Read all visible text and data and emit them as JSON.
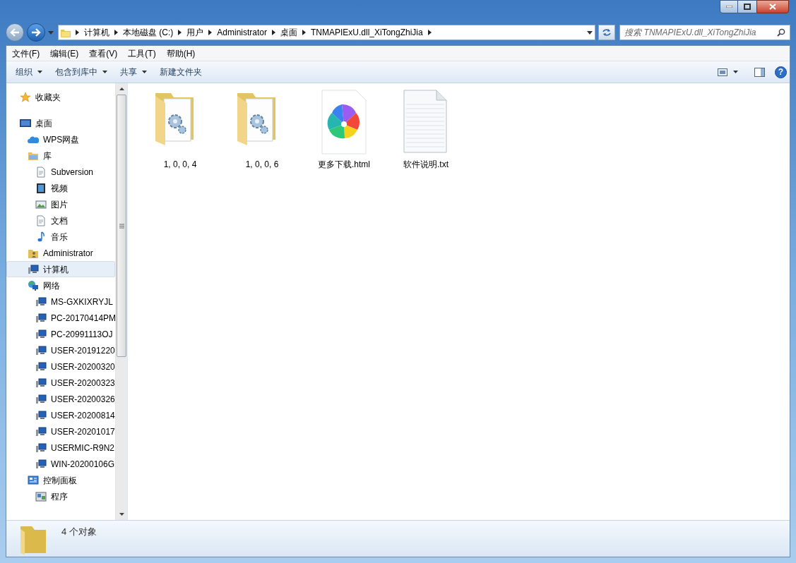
{
  "address_bar": {
    "segments": [
      "计算机",
      "本地磁盘 (C:)",
      "用户",
      "Administrator",
      "桌面",
      "TNMAPIExU.dll_XiTongZhiJia"
    ]
  },
  "search": {
    "placeholder": "搜索 TNMAPIExU.dll_XiTongZhiJia"
  },
  "menu_bar": [
    "文件(F)",
    "编辑(E)",
    "查看(V)",
    "工具(T)",
    "帮助(H)"
  ],
  "toolbar": [
    {
      "label": "组织",
      "dropdown": true
    },
    {
      "label": "包含到库中",
      "dropdown": true
    },
    {
      "label": "共享",
      "dropdown": true
    },
    {
      "label": "新建文件夹",
      "dropdown": false
    }
  ],
  "help_button": {
    "label": "?"
  },
  "sidebar": {
    "items": [
      {
        "label": "收藏夹",
        "kind": "star",
        "selected": false
      },
      {
        "label": "桌面",
        "kind": "desktop",
        "selected": false,
        "children": [
          {
            "label": "WPS网盘",
            "kind": "cloud",
            "selected": false
          },
          {
            "label": "库",
            "kind": "library",
            "selected": false,
            "children": [
              {
                "label": "Subversion",
                "kind": "document",
                "selected": false
              },
              {
                "label": "视频",
                "kind": "video",
                "selected": false
              },
              {
                "label": "图片",
                "kind": "picture",
                "selected": false
              },
              {
                "label": "文档",
                "kind": "document",
                "selected": false
              },
              {
                "label": "音乐",
                "kind": "music",
                "selected": false
              }
            ]
          },
          {
            "label": "Administrator",
            "kind": "user",
            "selected": false
          },
          {
            "label": "计算机",
            "kind": "computer",
            "selected": true
          },
          {
            "label": "网络",
            "kind": "network",
            "selected": false,
            "children": [
              {
                "label": "MS-GXKIXRYJL",
                "kind": "computer",
                "selected": false
              },
              {
                "label": "PC-20170414PM",
                "kind": "computer",
                "selected": false
              },
              {
                "label": "PC-20991113OJ",
                "kind": "computer",
                "selected": false
              },
              {
                "label": "USER-20191220",
                "kind": "computer",
                "selected": false
              },
              {
                "label": "USER-20200320",
                "kind": "computer",
                "selected": false
              },
              {
                "label": "USER-20200323",
                "kind": "computer",
                "selected": false
              },
              {
                "label": "USER-20200326",
                "kind": "computer",
                "selected": false
              },
              {
                "label": "USER-20200814",
                "kind": "computer",
                "selected": false
              },
              {
                "label": "USER-20201017",
                "kind": "computer",
                "selected": false
              },
              {
                "label": "USERMIC-R9N2",
                "kind": "computer",
                "selected": false
              },
              {
                "label": "WIN-20200106G",
                "kind": "computer",
                "selected": false
              }
            ]
          },
          {
            "label": "控制面板",
            "kind": "control-panel",
            "selected": false,
            "children": [
              {
                "label": "程序",
                "kind": "program",
                "selected": false
              }
            ]
          }
        ]
      }
    ]
  },
  "files": [
    {
      "name": "1, 0, 0, 4",
      "kind": "folder"
    },
    {
      "name": "1, 0, 0, 6",
      "kind": "folder"
    },
    {
      "name": "更多下载.html",
      "kind": "html"
    },
    {
      "name": "软件说明.txt",
      "kind": "text"
    }
  ],
  "status_bar": {
    "text": "4 个对象"
  }
}
